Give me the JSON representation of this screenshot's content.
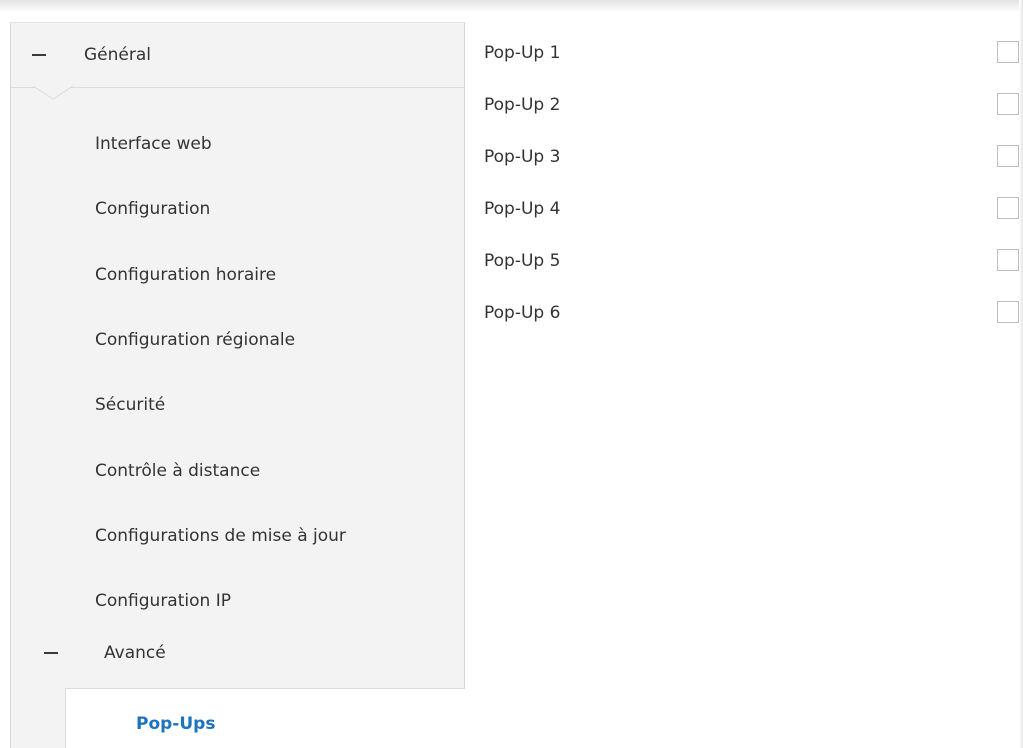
{
  "sidebar": {
    "general_label": "Général",
    "items": [
      {
        "label": "Interface web"
      },
      {
        "label": "Configuration"
      },
      {
        "label": "Configuration horaire"
      },
      {
        "label": "Configuration régionale"
      },
      {
        "label": "Sécurité"
      },
      {
        "label": "Contrôle à distance"
      },
      {
        "label": "Configurations de mise à jour"
      },
      {
        "label": "Configuration IP"
      }
    ],
    "advanced_label": "Avancé",
    "active_item_label": "Pop-Ups"
  },
  "content": {
    "popups": [
      {
        "label": "Pop-Up 1",
        "checked": false
      },
      {
        "label": "Pop-Up 2",
        "checked": false
      },
      {
        "label": "Pop-Up 3",
        "checked": false
      },
      {
        "label": "Pop-Up 4",
        "checked": false
      },
      {
        "label": "Pop-Up 5",
        "checked": false
      },
      {
        "label": "Pop-Up 6",
        "checked": false
      }
    ]
  },
  "colors": {
    "sidebar_bg": "#f3f3f3",
    "active_text": "#1e73be",
    "text": "#333333"
  }
}
